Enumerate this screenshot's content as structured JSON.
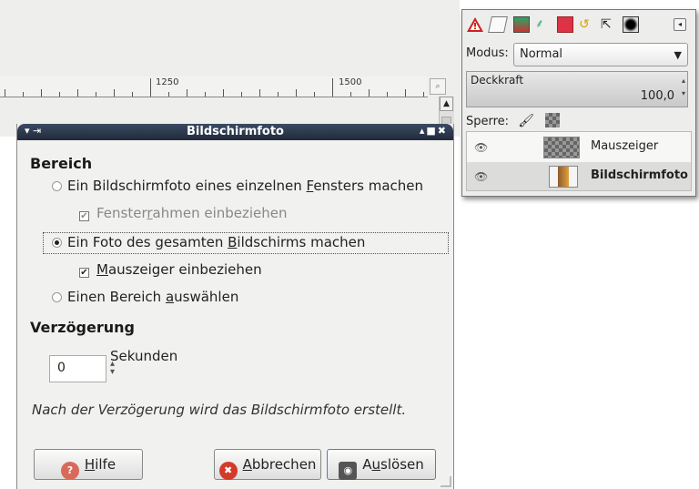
{
  "ruler": {
    "labels": [
      "1250",
      "1500"
    ]
  },
  "dialog": {
    "title": "Bildschirmfoto",
    "section_area": "Bereich",
    "options": {
      "single_window": {
        "pre": "Ein Bildschirmfoto eines einzelnen ",
        "ul": "F",
        "post": "ensters machen"
      },
      "window_frame": {
        "pre": "Fenster",
        "ul": "r",
        "post": "ahmen einbeziehen"
      },
      "whole_screen": {
        "pre": "Ein Foto des gesamten ",
        "ul": "B",
        "post": "ildschirms machen"
      },
      "include_pointer": {
        "pre": "",
        "ul": "M",
        "post": "auszeiger einbeziehen"
      },
      "select_region": {
        "pre": "Einen Bereich ",
        "ul": "a",
        "post": "uswählen"
      }
    },
    "section_delay": "Verzögerung",
    "delay_value": "0",
    "delay_unit": "Sekunden",
    "note": "Nach der Verzögerung wird das Bildschirmfoto erstellt.",
    "buttons": {
      "help": {
        "ul": "H",
        "post": "ilfe"
      },
      "cancel": {
        "ul": "A",
        "post": "bbrechen"
      },
      "snap": {
        "pre": "A",
        "ul": "u",
        "post": "slösen"
      }
    }
  },
  "layers": {
    "mode_label": "Modus:",
    "mode_value": "Normal",
    "opacity_label": "Deckkraft",
    "opacity_value": "100,0",
    "lock_label": "Sperre:",
    "items": [
      {
        "name": "Mauszeiger",
        "selected": false
      },
      {
        "name": "Bildschirmfoto",
        "selected": true
      }
    ]
  },
  "colors": {
    "title_bar": "#2a3448",
    "warning_red": "#cc2222",
    "cancel_red": "#d43a2a"
  }
}
